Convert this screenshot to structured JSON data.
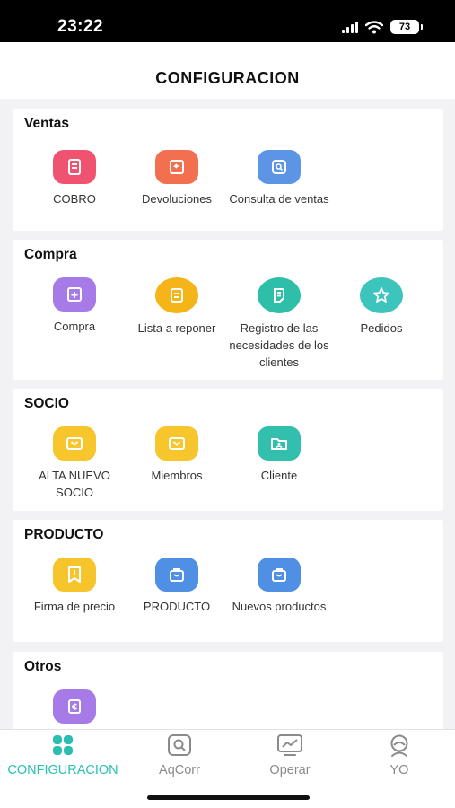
{
  "status_bar": {
    "time": "23:22",
    "battery": "73"
  },
  "header": {
    "title": "CONFIGURACION"
  },
  "sections": [
    {
      "title": "Ventas",
      "items": [
        {
          "label": "COBRO",
          "icon": "receipt-icon",
          "color": "#f0536f"
        },
        {
          "label": "Devoluciones",
          "icon": "return-icon",
          "color": "#f26f4f"
        },
        {
          "label": "Consulta de ventas",
          "icon": "search-icon",
          "color": "#5c95e6"
        }
      ]
    },
    {
      "title": "Compra",
      "items": [
        {
          "label": "Compra",
          "icon": "add-cart-icon",
          "color": "#a67be8"
        },
        {
          "label": "Lista a reponer",
          "icon": "list-icon",
          "color": "#f5b417"
        },
        {
          "label": "Registro de las necesidades de los clientes",
          "icon": "notes-icon",
          "color": "#2fbfa8"
        },
        {
          "label": "Pedidos",
          "icon": "star-icon",
          "color": "#3cc4bd"
        }
      ]
    },
    {
      "title": "SOCIO",
      "items": [
        {
          "label": "ALTA NUEVO SOCIO",
          "icon": "member-card-icon",
          "color": "#f7c52c"
        },
        {
          "label": "Miembros",
          "icon": "member-card-icon",
          "color": "#f7c52c"
        },
        {
          "label": "Cliente",
          "icon": "customer-folder-icon",
          "color": "#33bfae"
        }
      ]
    },
    {
      "title": "PRODUCTO",
      "items": [
        {
          "label": "Firma de precio",
          "icon": "price-tag-icon",
          "color": "#f6c42b"
        },
        {
          "label": "PRODUCTO",
          "icon": "shopping-bag-icon",
          "color": "#4f8fe4"
        },
        {
          "label": "Nuevos productos",
          "icon": "shopping-bag-icon",
          "color": "#4f8fe4"
        }
      ]
    },
    {
      "title": "Otros",
      "items": [
        {
          "label": "",
          "icon": "euro-icon",
          "color": "#a67be8"
        }
      ]
    }
  ],
  "tabs": [
    {
      "label": "CONFIGURACION",
      "icon": "grid-icon",
      "active": true
    },
    {
      "label": "AqCorr",
      "icon": "search-icon",
      "active": false
    },
    {
      "label": "Operar",
      "icon": "chart-icon",
      "active": false
    },
    {
      "label": "YO",
      "icon": "profile-icon",
      "active": false
    }
  ],
  "colors": {
    "accent": "#2bbfb3",
    "background": "#f2f2f5"
  }
}
